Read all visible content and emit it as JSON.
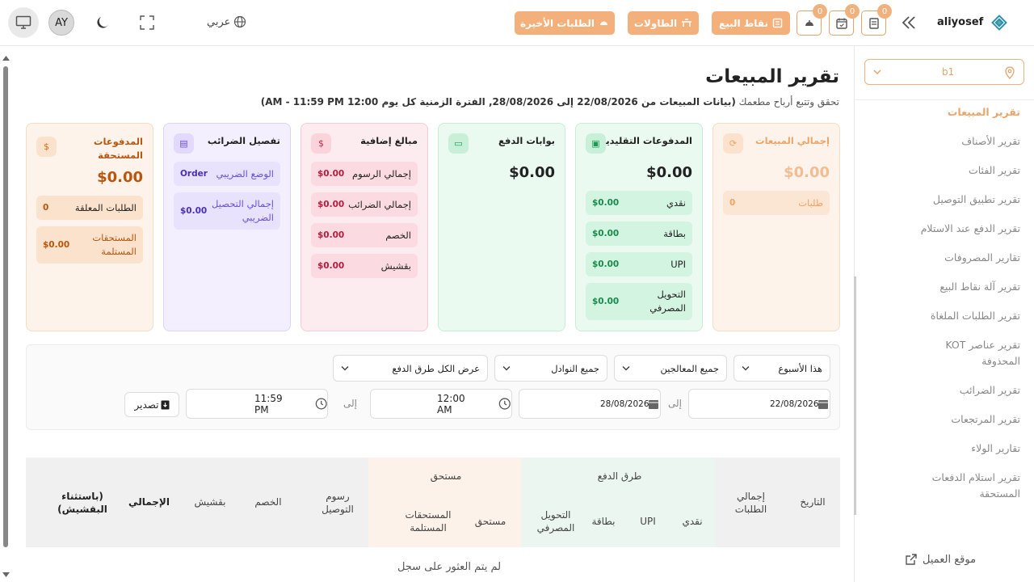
{
  "header": {
    "brand": "aliyosef",
    "buttons": {
      "recent_orders": "الطلبات الأخيرة",
      "tables": "الطاولات",
      "pos": "نقاط البيع"
    },
    "badges": [
      "0",
      "0",
      "0"
    ],
    "language": "عربي",
    "avatar": "AY"
  },
  "sidebar": {
    "branch": "b1",
    "items": [
      {
        "label": "تقرير المبيعات",
        "active": true
      },
      {
        "label": "تقرير الأصناف"
      },
      {
        "label": "تقرير الفئات"
      },
      {
        "label": "تقرير تطبيق التوصيل"
      },
      {
        "label": "تقرير الدفع عند الاستلام"
      },
      {
        "label": "تقارير المصروفات"
      },
      {
        "label": "تقرير آلة نقاط البيع"
      },
      {
        "label": "تقرير الطلبات الملغاة"
      },
      {
        "label": "تقرير عناصر KOT المحذوفة"
      },
      {
        "label": "تقرير الضرائب"
      },
      {
        "label": "تقرير المرتجعات"
      },
      {
        "label": "تقارير الولاء"
      },
      {
        "label": "تقرير استلام الدفعات المستحقة"
      }
    ],
    "customer_site": "موقع العميل"
  },
  "page": {
    "title": "تقرير المبيعات",
    "subtitle_prefix": "تحقق وتتبع أرباح مطعمك",
    "subtitle_detail": "(بيانات المبيعات من 22/08/2026 إلى 28/08/2026, الفترة الزمنية كل يوم 12:00 AM - 11:59 PM)"
  },
  "cards": {
    "total_sales": {
      "title": "إجمالي المبيعات",
      "value": "$0.00",
      "orders_label": "طلبات",
      "orders_value": "0"
    },
    "traditional": {
      "title": "المدفوعات التقليدية",
      "value": "$0.00",
      "rows": [
        {
          "label": "نقدي",
          "value": "$0.00"
        },
        {
          "label": "بطاقة",
          "value": "$0.00"
        },
        {
          "label": "UPI",
          "value": "$0.00"
        },
        {
          "label": "التحويل المصرفي",
          "value": "$0.00"
        }
      ]
    },
    "gateways": {
      "title": "بوابات الدفع",
      "value": "$0.00"
    },
    "extra": {
      "title": "مبالغ إضافية",
      "rows": [
        {
          "label": "إجمالي الرسوم",
          "value": "$0.00"
        },
        {
          "label": "إجمالي الضرائب",
          "value": "$0.00"
        },
        {
          "label": "الخصم",
          "value": "$0.00"
        },
        {
          "label": "بقشيش",
          "value": "$0.00"
        }
      ]
    },
    "tax": {
      "title": "تفصيل الضرائب",
      "rows": [
        {
          "label": "الوضع الضريبي",
          "value": "Order"
        },
        {
          "label": "إجمالي التحصيل الضريبي",
          "value": "$0.00"
        }
      ]
    },
    "due": {
      "title": "المدفوعات المستحقة",
      "value": "$0.00",
      "rows": [
        {
          "label": "الطلبات المعلقة",
          "value": "0"
        },
        {
          "label": "المستحقات المستلمة",
          "value": "$0.00"
        }
      ]
    }
  },
  "filters": {
    "period": "هذا الأسبوع",
    "processors": "جميع المعالجين",
    "waiters": "جميع النوادل",
    "payment_methods": "عرض الكل طرق الدفع",
    "start_date": "22/08/2026",
    "end_date": "28/08/2026",
    "to_label": "إلى",
    "start_time": "12:00 AM",
    "end_time": "11:59 PM",
    "export": "تصدير"
  },
  "table": {
    "headers": {
      "date": "التاريخ",
      "total_orders": "إجمالي الطلبات",
      "payment_methods": "طرق الدفع",
      "cash": "نقدي",
      "upi": "UPI",
      "card": "بطاقة",
      "bank": "التحويل المصرفي",
      "due_group": "مستحق",
      "due": "مستحق",
      "due_received": "المستحقات المستلمة",
      "delivery_fees": "رسوم التوصيل",
      "discount": "الخصم",
      "tips": "بقشيش",
      "total": "الإجمالي",
      "excl_tips": "(باستثناء البقشيش)"
    },
    "empty": "لم يتم العثور على سجل"
  },
  "colors": {
    "accent": "#f4b07a",
    "orange_card": "#fdf3ea",
    "green_card": "#eafaf1",
    "red_card": "#fdecef",
    "purple_card": "#f3efff"
  }
}
